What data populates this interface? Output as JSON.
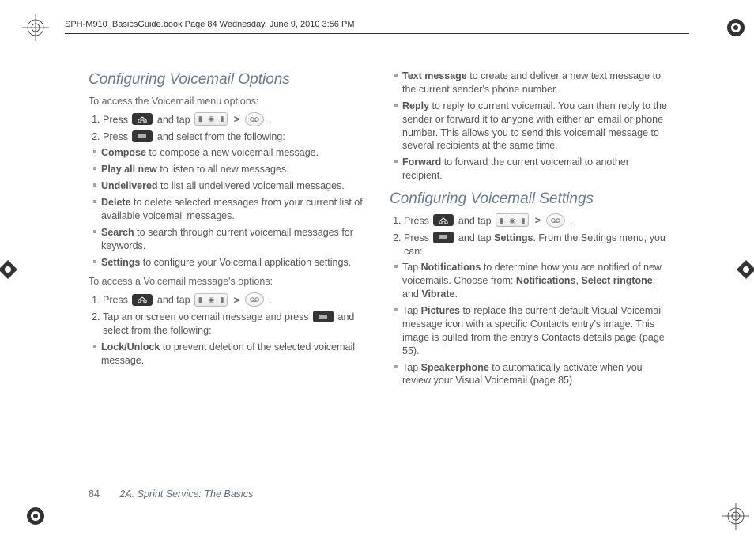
{
  "doc_header": "SPH-M910_BasicsGuide.book  Page 84  Wednesday, June 9, 2010  3:56 PM",
  "footer": {
    "page": "84",
    "chapter": "2A. Sprint Service: The Basics"
  },
  "sec1": {
    "title": "Configuring Voicemail Options",
    "lead1": "To access the Voicemail menu options:",
    "steps1": {
      "s1a": "Press",
      "s1b": "and tap",
      "s1gt1": ">",
      "s1end": ".",
      "s2a": "Press",
      "s2b": "and select from the following:"
    },
    "opts1": {
      "compose_t": "Compose",
      "compose": " to compose a new voicemail message.",
      "playall_t": "Play all new",
      "playall": " to listen to all new messages.",
      "undeliv_t": "Undelivered",
      "undeliv": " to list all undelivered voicemail messages.",
      "delete_t": "Delete",
      "delete": " to delete selected messages from your current list of available voicemail messages.",
      "search_t": "Search",
      "search": " to search through current voicemail messages for keywords.",
      "settings_t": "Settings",
      "settings": " to configure your Voicemail application settings."
    },
    "lead2": "To access a Voicemail message's options:",
    "steps2": {
      "s1a": "Press",
      "s1b": "and tap",
      "s1gt1": ">",
      "s1end": ".",
      "s2a": "Tap an onscreen voicemail message and press",
      "s2b": "and select from the following:"
    },
    "opts2": {
      "lock_t": "Lock/Unlock",
      "lock": " to prevent deletion of the selected voicemail message."
    }
  },
  "sec1b_opts": {
    "text_t": "Text message",
    "text": " to create and deliver a new text message to the current sender's phone number.",
    "reply_t": "Reply",
    "reply": " to reply to current voicemail. You can then reply to the sender or forward it to anyone with either an email or phone number. This allows you to send this voicemail message to several recipients at the same time.",
    "fwd_t": "Forward",
    "fwd": " to forward the current voicemail to another recipient."
  },
  "sec2": {
    "title": "Configuring Voicemail Settings",
    "steps": {
      "s1a": "Press",
      "s1b": "and tap",
      "s1gt1": ">",
      "s1end": ".",
      "s2a": "Press",
      "s2b": "and tap ",
      "s2term": "Settings",
      "s2c": ". From the Settings menu, you can:"
    },
    "opts": {
      "n1_a": "Tap ",
      "n1_t": "Notifications",
      "n1_b": " to determine how you are notified of new voicemails. Choose from: ",
      "n1_c1": "Notifications",
      "n1_sep1": ", ",
      "n1_c2": "Select ringtone",
      "n1_sep2": ", and ",
      "n1_c3": "Vibrate",
      "n1_end": ".",
      "p_a": "Tap ",
      "p_t": "Pictures",
      "p_b": " to replace the current default Visual Voicemail message icon with a specific Contacts entry's image. This image is pulled from the entry's Contacts details page (page 55).",
      "s_a": "Tap ",
      "s_t": "Speakerphone",
      "s_b": " to automatically activate when you review your Visual Voicemail (page 85)."
    }
  }
}
